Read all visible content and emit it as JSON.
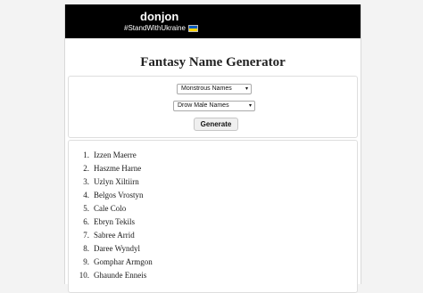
{
  "header": {
    "site_title": "donjon",
    "tagline": "#StandWithUkraine",
    "flag_icon": "ukraine-flag-icon"
  },
  "page_title": "Fantasy Name Generator",
  "form": {
    "category_value": "Monstrous Names",
    "subtype_value": "Drow Male Names",
    "generate_label": "Generate"
  },
  "results": [
    {
      "num": "1.",
      "name": "Izzen Maerre"
    },
    {
      "num": "2.",
      "name": "Haszme Harne"
    },
    {
      "num": "3.",
      "name": "Uzlyn Xiltiirn"
    },
    {
      "num": "4.",
      "name": "Belgos Vrostyn"
    },
    {
      "num": "5.",
      "name": "Cale Colo"
    },
    {
      "num": "6.",
      "name": "Ebryn Tekils"
    },
    {
      "num": "7.",
      "name": "Sabree Arrid"
    },
    {
      "num": "8.",
      "name": "Daree Wyndyl"
    },
    {
      "num": "9.",
      "name": "Gomphar Armgon"
    },
    {
      "num": "10.",
      "name": "Ghaunde Enneis"
    }
  ]
}
